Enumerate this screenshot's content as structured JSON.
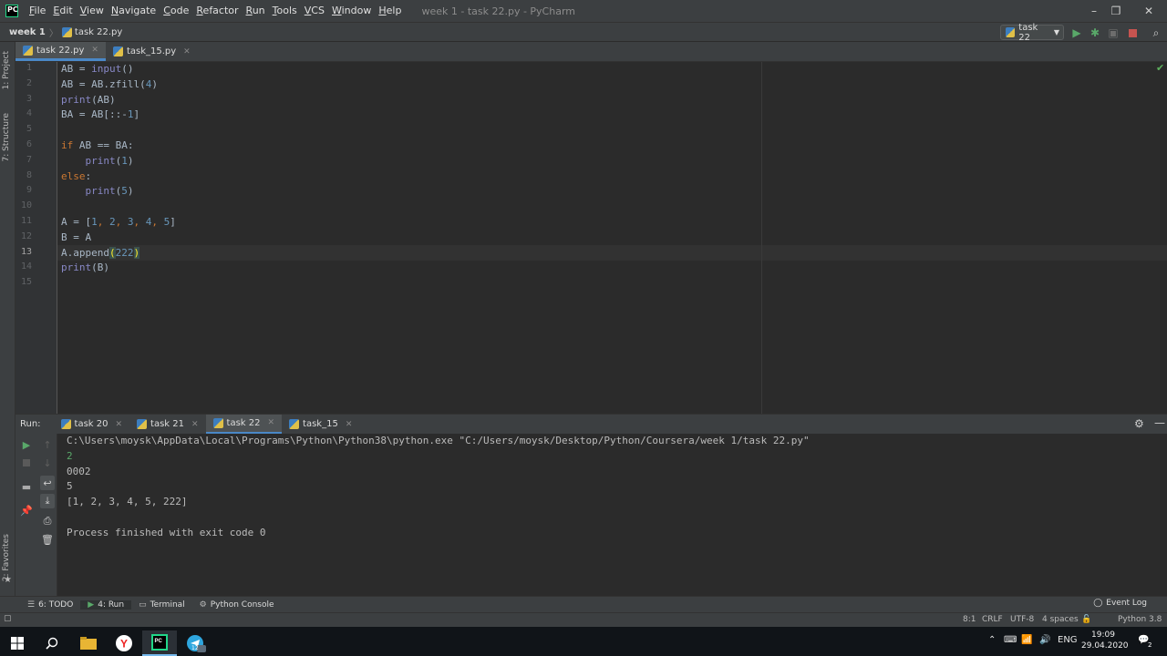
{
  "window": {
    "title": "week 1 - task 22.py - PyCharm",
    "logo_text": "PC",
    "controls": [
      "–",
      "❐",
      "✕"
    ]
  },
  "menu": [
    {
      "u": "F",
      "rest": "ile"
    },
    {
      "u": "E",
      "rest": "dit"
    },
    {
      "u": "V",
      "rest": "iew"
    },
    {
      "u": "N",
      "rest": "avigate"
    },
    {
      "u": "C",
      "rest": "ode"
    },
    {
      "u": "R",
      "rest": "efactor"
    },
    {
      "u": "R",
      "rest": "un"
    },
    {
      "u": "T",
      "rest": "ools"
    },
    {
      "u": "V",
      "rest": "CS"
    },
    {
      "u": "W",
      "rest": "indow"
    },
    {
      "u": "H",
      "rest": "elp"
    }
  ],
  "navbar": {
    "project": "week 1",
    "file": "task 22.py",
    "run_config": "task 22"
  },
  "left_strip": {
    "project_label": "1: Project",
    "structure_label": "7: Structure",
    "favorites_label": "2: Favorites"
  },
  "editor_tabs": [
    {
      "label": "task 22.py",
      "active": true
    },
    {
      "label": "task_15.py",
      "active": false
    }
  ],
  "code": {
    "line_numbers": [
      "1",
      "2",
      "3",
      "4",
      "5",
      "6",
      "7",
      "8",
      "9",
      "10",
      "11",
      "12",
      "13",
      "14",
      "15"
    ],
    "current_line": 13,
    "lines": [
      "AB = input()",
      "AB = AB.zfill(4)",
      "print(AB)",
      "BA = AB[::-1]",
      "",
      "if AB == BA:",
      "    print(1)",
      "else:",
      "    print(5)",
      "",
      "A = [1, 2, 3, 4, 5]",
      "B = A",
      "A.append(222)",
      "print(B)",
      ""
    ]
  },
  "run_panel": {
    "title": "Run:",
    "tabs": [
      {
        "label": "task 20",
        "active": false
      },
      {
        "label": "task 21",
        "active": false
      },
      {
        "label": "task 22",
        "active": true
      },
      {
        "label": "task_15",
        "active": false
      }
    ],
    "console": [
      {
        "text": "C:\\Users\\moysk\\AppData\\Local\\Programs\\Python\\Python38\\python.exe \"C:/Users/moysk/Desktop/Python/Coursera/week 1/task 22.py\"",
        "kind": "cmd"
      },
      {
        "text": "2",
        "kind": "input"
      },
      {
        "text": "0002",
        "kind": "out"
      },
      {
        "text": "5",
        "kind": "out"
      },
      {
        "text": "[1, 2, 3, 4, 5, 222]",
        "kind": "out"
      },
      {
        "text": "",
        "kind": "out"
      },
      {
        "text": "Process finished with exit code 0",
        "kind": "out"
      }
    ]
  },
  "bottom_tabs": [
    {
      "label": "6: TODO",
      "active": false
    },
    {
      "label": "4: Run",
      "active": true
    },
    {
      "label": "Terminal",
      "active": false
    },
    {
      "label": "Python Console",
      "active": false
    }
  ],
  "event_log": "Event Log",
  "status": {
    "position": "8:1",
    "line_sep": "CRLF",
    "encoding": "UTF-8",
    "indent": "4 spaces",
    "interpreter": "Python 3.8"
  },
  "taskbar": {
    "lang": "ENG",
    "time": "19:09",
    "date": "29.04.2020",
    "notif_count": "2",
    "telegram_badge": "12"
  },
  "colors": {
    "accent": "#4a88c7",
    "keyword": "#cc7832",
    "builtin": "#8888c6",
    "number": "#6897bb",
    "run_green": "#59a869"
  }
}
